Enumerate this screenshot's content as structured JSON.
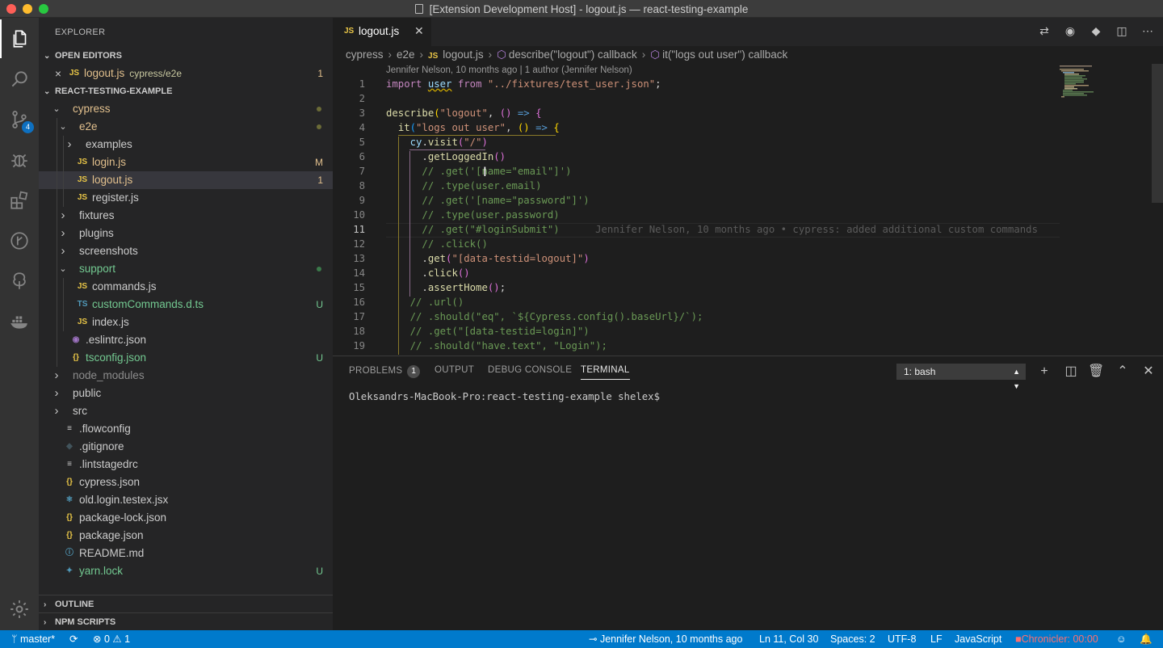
{
  "window": {
    "title": "[Extension Development Host] - logout.js — react-testing-example"
  },
  "activity_bar": {
    "scm_badge": "4"
  },
  "sidebar": {
    "header": "EXPLORER",
    "open_editors": {
      "title": "OPEN EDITORS",
      "items": [
        {
          "name": "logout.js",
          "path": "cypress/e2e",
          "status": "1"
        }
      ]
    },
    "project": {
      "title": "REACT-TESTING-EXAMPLE",
      "items": [
        {
          "name": "cypress",
          "type": "folder",
          "open": true,
          "depth": 0,
          "color": "#e2c08d",
          "dot": true
        },
        {
          "name": "e2e",
          "type": "folder",
          "open": true,
          "depth": 1,
          "color": "#e2c08d",
          "dot": true
        },
        {
          "name": "examples",
          "type": "folder",
          "open": false,
          "depth": 2,
          "color": "#cccccc"
        },
        {
          "name": "login.js",
          "type": "js",
          "depth": 2,
          "color": "#e2c08d",
          "status": "M"
        },
        {
          "name": "logout.js",
          "type": "js",
          "depth": 2,
          "color": "#e2c08d",
          "status": "1",
          "selected": true
        },
        {
          "name": "register.js",
          "type": "js",
          "depth": 2,
          "color": "#cccccc"
        },
        {
          "name": "fixtures",
          "type": "folder",
          "open": false,
          "depth": 1,
          "color": "#cccccc"
        },
        {
          "name": "plugins",
          "type": "folder",
          "open": false,
          "depth": 1,
          "color": "#cccccc"
        },
        {
          "name": "screenshots",
          "type": "folder",
          "open": false,
          "depth": 1,
          "color": "#cccccc"
        },
        {
          "name": "support",
          "type": "folder",
          "open": true,
          "depth": 1,
          "color": "#73c991",
          "dot_green": true
        },
        {
          "name": "commands.js",
          "type": "js",
          "depth": 2,
          "color": "#cccccc"
        },
        {
          "name": "customCommands.d.ts",
          "type": "ts",
          "depth": 2,
          "color": "#73c991",
          "status": "U"
        },
        {
          "name": "index.js",
          "type": "js",
          "depth": 2,
          "color": "#cccccc"
        },
        {
          "name": ".eslintrc.json",
          "type": "eslint",
          "depth": 1,
          "color": "#cccccc"
        },
        {
          "name": "tsconfig.json",
          "type": "json",
          "depth": 1,
          "color": "#73c991",
          "status": "U"
        },
        {
          "name": "node_modules",
          "type": "folder",
          "open": false,
          "depth": 0,
          "color": "#8c8c8c"
        },
        {
          "name": "public",
          "type": "folder",
          "open": false,
          "depth": 0,
          "color": "#cccccc"
        },
        {
          "name": "src",
          "type": "folder",
          "open": false,
          "depth": 0,
          "color": "#cccccc"
        },
        {
          "name": ".flowconfig",
          "type": "lines",
          "depth": 0,
          "color": "#cccccc"
        },
        {
          "name": ".gitignore",
          "type": "git",
          "depth": 0,
          "color": "#cccccc"
        },
        {
          "name": ".lintstagedrc",
          "type": "lines",
          "depth": 0,
          "color": "#cccccc"
        },
        {
          "name": "cypress.json",
          "type": "json",
          "depth": 0,
          "color": "#cccccc"
        },
        {
          "name": "old.login.testex.jsx",
          "type": "react",
          "depth": 0,
          "color": "#cccccc"
        },
        {
          "name": "package-lock.json",
          "type": "json",
          "depth": 0,
          "color": "#cccccc"
        },
        {
          "name": "package.json",
          "type": "json",
          "depth": 0,
          "color": "#cccccc"
        },
        {
          "name": "README.md",
          "type": "info",
          "depth": 0,
          "color": "#cccccc"
        },
        {
          "name": "yarn.lock",
          "type": "yarn",
          "depth": 0,
          "color": "#73c991",
          "status": "U"
        }
      ]
    },
    "outline": "OUTLINE",
    "npm_scripts": "NPM SCRIPTS"
  },
  "editor": {
    "tab": "logout.js",
    "breadcrumb": [
      "cypress",
      "e2e",
      "logout.js",
      "describe(\"logout\") callback",
      "it(\"logs out user\") callback"
    ],
    "codelens": "Jennifer Nelson, 10 months ago | 1 author (Jennifer Nelson)",
    "current_line": 11,
    "blame": "Jennifer Nelson, 10 months ago • cypress: added additional custom commands",
    "lines": [
      [
        [
          "kw",
          "import "
        ],
        [
          "vr",
          "user"
        ],
        [
          "kw",
          " from "
        ],
        [
          "st2",
          "\"../fixtures/test_user.json\""
        ],
        [
          "pl",
          ";"
        ]
      ],
      [],
      [
        [
          "fn",
          "describe"
        ],
        [
          "br1",
          "("
        ],
        [
          "st2",
          "\"logout\""
        ],
        [
          "pl",
          ", "
        ],
        [
          "br2",
          "()"
        ],
        [
          "op",
          " => "
        ],
        [
          "br2",
          "{"
        ]
      ],
      [
        [
          "pl",
          "  "
        ],
        [
          "fn",
          "it"
        ],
        [
          "br3",
          "("
        ],
        [
          "st2",
          "\"logs out user\""
        ],
        [
          "pl",
          ", "
        ],
        [
          "br1",
          "()"
        ],
        [
          "op",
          " => "
        ],
        [
          "br1",
          "{"
        ]
      ],
      [
        [
          "pl",
          "    "
        ],
        [
          "vr",
          "cy"
        ],
        [
          "pl",
          "."
        ],
        [
          "fn",
          "visit"
        ],
        [
          "br2",
          "("
        ],
        [
          "st2",
          "\"/\""
        ],
        [
          "br2",
          ")"
        ]
      ],
      [
        [
          "pl",
          "      ."
        ],
        [
          "fn",
          "getLoggedIn"
        ],
        [
          "br2",
          "()"
        ]
      ],
      [
        [
          "cm",
          "      // .get('[name=\"email\"]')"
        ]
      ],
      [
        [
          "cm",
          "      // .type(user.email)"
        ]
      ],
      [
        [
          "cm",
          "      // .get('[name=\"password\"]')"
        ]
      ],
      [
        [
          "cm",
          "      // .type(user.password)"
        ]
      ],
      [
        [
          "cm",
          "      // .get(\"#loginSubmit\")"
        ]
      ],
      [
        [
          "cm",
          "      // .click()"
        ]
      ],
      [
        [
          "pl",
          "      ."
        ],
        [
          "fn",
          "get"
        ],
        [
          "br2",
          "("
        ],
        [
          "st2",
          "\"[data-testid=logout]\""
        ],
        [
          "br2",
          ")"
        ]
      ],
      [
        [
          "pl",
          "      ."
        ],
        [
          "fn",
          "click"
        ],
        [
          "br2",
          "()"
        ]
      ],
      [
        [
          "pl",
          "      ."
        ],
        [
          "fn",
          "assertHome"
        ],
        [
          "br2",
          "()"
        ],
        [
          "pl",
          ";"
        ]
      ],
      [
        [
          "cm",
          "    // .url()"
        ]
      ],
      [
        [
          "cm",
          "    // .should(\"eq\", `${Cypress.config().baseUrl}/`);"
        ]
      ],
      [
        [
          "cm",
          "    // .get(\"[data-testid=login]\")"
        ]
      ],
      [
        [
          "cm",
          "    // .should(\"have.text\", \"Login\");"
        ]
      ]
    ]
  },
  "panel": {
    "tabs": [
      "PROBLEMS",
      "OUTPUT",
      "DEBUG CONSOLE",
      "TERMINAL"
    ],
    "problems_count": "1",
    "active_tab": "TERMINAL",
    "terminal_select": "1: bash",
    "prompt": "Oleksandrs-MacBook-Pro:react-testing-example shelex$"
  },
  "statusbar": {
    "branch": "master*",
    "errors": "0",
    "warnings": "1",
    "blame": "Jennifer Nelson, 10 months ago",
    "position": "Ln 11, Col 30",
    "spaces": "Spaces: 2",
    "encoding": "UTF-8",
    "eol": "LF",
    "language": "JavaScript",
    "chronicler": "Chronicler: 00:00"
  },
  "colors": {
    "accent": "#007acc",
    "added": "#73c991",
    "modified": "#e2c08d"
  }
}
